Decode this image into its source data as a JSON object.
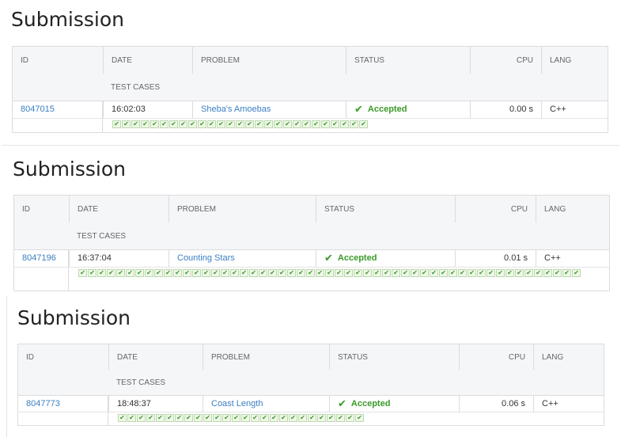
{
  "columns": {
    "id": "ID",
    "date": "DATE",
    "problem": "PROBLEM",
    "status": "STATUS",
    "cpu": "CPU",
    "lang": "LANG",
    "test_cases": "TEST CASES"
  },
  "submissions": [
    {
      "title": "Submission",
      "id": "8047015",
      "date": "16:02:03",
      "problem": "Sheba's Amoebas",
      "status": "Accepted",
      "cpu": "0.00 s",
      "lang": "C++",
      "test_cases_passed": 27
    },
    {
      "title": "Submission",
      "id": "8047196",
      "date": "16:37:04",
      "problem": "Counting Stars",
      "status": "Accepted",
      "cpu": "0.01 s",
      "lang": "C++",
      "test_cases_passed": 53
    },
    {
      "title": "Submission",
      "id": "8047773",
      "date": "18:48:37",
      "problem": "Coast Length",
      "status": "Accepted",
      "cpu": "0.06 s",
      "lang": "C++",
      "test_cases_passed": 26
    }
  ],
  "icons": {
    "accepted": "check-icon",
    "test_case": "check-icon"
  },
  "colors": {
    "accepted": "#3a9a27",
    "link": "#3b7fc4"
  }
}
